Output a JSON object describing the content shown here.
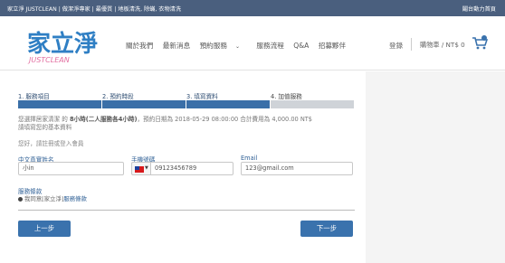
{
  "topbar": {
    "left": "家立淨 JUSTCLEAN | 做潔淨專家 | 最優質 | 地板清洗, 除蟎, 衣物清洗",
    "right": "鬮台動力首頁"
  },
  "logo": {
    "chars": "家立淨",
    "sub": "JUSTCLEAN"
  },
  "nav": {
    "items": [
      "關於我們",
      "最新消息",
      "預約服務",
      "服務流程",
      "Q&A",
      "招募夥伴"
    ],
    "login": "登錄",
    "cart": "購物車 / NT$ 0"
  },
  "steps": [
    {
      "label": "1. 服務項目",
      "active": true
    },
    {
      "label": "2. 預約時段",
      "active": true
    },
    {
      "label": "3. 填寫資料",
      "active": true
    },
    {
      "label": "4. 加值服務",
      "active": false
    }
  ],
  "info": {
    "line1_a": "您選擇居家清潔",
    "line1_b": "的",
    "line1_c": "8小時(二人服務各4小時)",
    "line1_d": "，預約日期為 2018-05-29 08:00:00 合計費用為 4,000.00 NT$",
    "line2": "請填寫您的基本資料"
  },
  "prompt": {
    "text": "您好，請註冊或登入會員",
    "link": "登入"
  },
  "form": {
    "name_label": "中文真實姓名",
    "name_value": "小in",
    "phone_label": "手機號碼",
    "phone_value": "09123456789",
    "email_label": "Email",
    "email_value": "123@gmail.com"
  },
  "terms": {
    "title": "服務條款",
    "text": "我同意[家立淨]",
    "link": "服務條款"
  },
  "buttons": {
    "prev": "上一步",
    "next": "下一步"
  }
}
